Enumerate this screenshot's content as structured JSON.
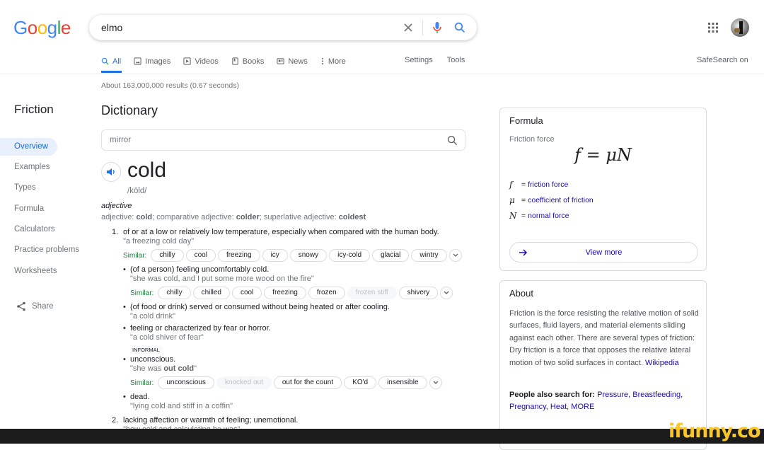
{
  "header": {
    "logo_letters": [
      {
        "ch": "G",
        "color": "#4285f4"
      },
      {
        "ch": "o",
        "color": "#ea4335"
      },
      {
        "ch": "o",
        "color": "#fbbc05"
      },
      {
        "ch": "g",
        "color": "#4285f4"
      },
      {
        "ch": "l",
        "color": "#34a853"
      },
      {
        "ch": "e",
        "color": "#ea4335"
      }
    ],
    "query": "elmo",
    "icons": [
      "clear-icon",
      "microphone-icon",
      "search-icon",
      "apps-grid-icon",
      "avatar"
    ]
  },
  "tabs": [
    {
      "label": "All",
      "icon": "search-icon",
      "active": true
    },
    {
      "label": "Images",
      "icon": "image-icon"
    },
    {
      "label": "Videos",
      "icon": "video-icon"
    },
    {
      "label": "Books",
      "icon": "book-icon"
    },
    {
      "label": "News",
      "icon": "news-icon"
    },
    {
      "label": "More",
      "icon": "more-vert-icon"
    }
  ],
  "tabs_right": {
    "settings": "Settings",
    "tools": "Tools"
  },
  "safesearch": "SafeSearch on",
  "results_stats": "About 163,000,000 results (0.67 seconds)",
  "leftnav": {
    "title": "Friction",
    "items": [
      "Overview",
      "Examples",
      "Types",
      "Formula",
      "Calculators",
      "Practice problems",
      "Worksheets"
    ],
    "active": "Overview",
    "share": "Share"
  },
  "dictionary": {
    "title": "Dictionary",
    "search_value": "mirror",
    "word": "cold",
    "phonetic": "/kōld/",
    "pos": "adjective",
    "forms": {
      "prefix": "adjective: ",
      "base": "cold",
      "comp_label": "; comparative adjective: ",
      "comp": "colder",
      "sup_label": "; superlative adjective: ",
      "sup": "coldest"
    },
    "similar_label": "Similar:",
    "informal_label": "INFORMAL",
    "senses": [
      {
        "num": "1.",
        "def": "of or at a low or relatively low temperature, especially when compared with the human body.",
        "example": "\"a freezing cold day\"",
        "similar": [
          {
            "t": "chilly"
          },
          {
            "t": "cool"
          },
          {
            "t": "freezing"
          },
          {
            "t": "icy"
          },
          {
            "t": "snowy"
          },
          {
            "t": "icy-cold"
          },
          {
            "t": "glacial"
          },
          {
            "t": "wintry"
          }
        ]
      },
      {
        "bullet": true,
        "def": "(of a person) feeling uncomfortably cold.",
        "example": "\"she was cold, and I put some more wood on the fire\"",
        "similar": [
          {
            "t": "chilly"
          },
          {
            "t": "chilled"
          },
          {
            "t": "cool"
          },
          {
            "t": "freezing"
          },
          {
            "t": "frozen"
          },
          {
            "t": "frozen stiff",
            "disabled": true
          },
          {
            "t": "shivery"
          }
        ]
      },
      {
        "bullet": true,
        "def": "(of food or drink) served or consumed without being heated or after cooling.",
        "example": "\"a cold drink\""
      },
      {
        "bullet": true,
        "def": "feeling or characterized by fear or horror.",
        "example": "\"a cold shiver of fear\""
      },
      {
        "bullet": true,
        "informal": true,
        "def": "unconscious.",
        "example_pre": "\"she was ",
        "example_bold": "out cold",
        "example_post": "\"",
        "similar": [
          {
            "t": "unconscious"
          },
          {
            "t": "knocked out",
            "disabled": true
          },
          {
            "t": "out for the count"
          },
          {
            "t": "KO'd"
          },
          {
            "t": "insensible"
          }
        ]
      },
      {
        "bullet": true,
        "def": "dead.",
        "example": "\"lying cold and stiff in a coffin\""
      },
      {
        "num": "2.",
        "def": "lacking affection or warmth of feeling; unemotional.",
        "example": "\"how cold and calculating he was\""
      }
    ]
  },
  "formula_card": {
    "title": "Formula",
    "subtitle": "Friction force",
    "formula": "f = μN",
    "vars": [
      {
        "sym": "f",
        "eq": "=",
        "desc": "friction force"
      },
      {
        "sym": "μ",
        "eq": "=",
        "desc": "coefficient of friction"
      },
      {
        "sym": "N",
        "eq": "=",
        "desc": "normal force"
      }
    ],
    "view_more": "View more"
  },
  "about_card": {
    "title": "About",
    "text": "Friction is the force resisting the relative motion of solid surfaces, fluid layers, and material elements sliding against each other. There are several types of friction: Dry friction is a force that opposes the relative lateral motion of two solid surfaces in contact. ",
    "source": "Wikipedia",
    "pas_label": "People also search for: ",
    "pas_links": [
      "Pressure",
      "Breastfeeding",
      "Pregnancy",
      "Heat",
      "MORE"
    ]
  },
  "watermark": "ifunny.co"
}
